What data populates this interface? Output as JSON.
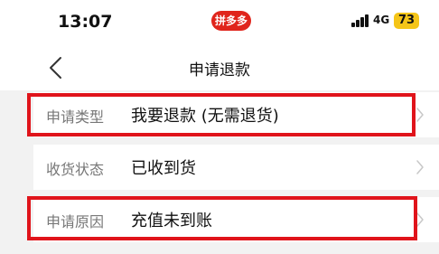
{
  "status_bar": {
    "time": "13:07",
    "app_badge": "拼多多",
    "network": "4G",
    "battery": "73"
  },
  "nav": {
    "title": "申请退款",
    "back_icon": "chevron-left-icon"
  },
  "form": {
    "rows": [
      {
        "label": "申请类型",
        "value": "我要退款 (无需退货)",
        "highlighted": true
      },
      {
        "label": "收货状态",
        "value": "已收到货",
        "highlighted": false
      },
      {
        "label": "申请原因",
        "value": "充值未到账",
        "highlighted": true
      }
    ]
  },
  "colors": {
    "highlight": "#e0141b",
    "brand": "#e0251c",
    "battery": "#f5c518"
  }
}
